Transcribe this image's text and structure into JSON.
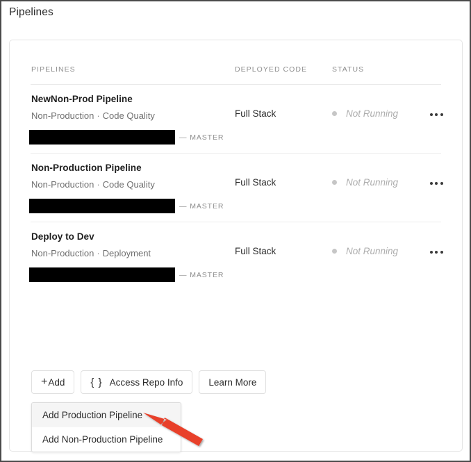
{
  "page": {
    "title": "Pipelines"
  },
  "table": {
    "headers": {
      "pipelines": "PIPELINES",
      "deployed_code": "DEPLOYED CODE",
      "status": "STATUS"
    },
    "rows": [
      {
        "name": "NewNon-Prod Pipeline",
        "environment": "Non-Production",
        "separator": "·",
        "type": "Code Quality",
        "repo_redacted": true,
        "branch": "— MASTER",
        "deployed_code": "Full Stack",
        "status": "Not Running",
        "status_color": "#c6c6c6",
        "menu_icon": "ellipsis-icon"
      },
      {
        "name": "Non-Production Pipeline",
        "environment": "Non-Production",
        "separator": "·",
        "type": "Code Quality",
        "repo_redacted": true,
        "branch": "— MASTER",
        "deployed_code": "Full Stack",
        "status": "Not Running",
        "status_color": "#c6c6c6",
        "menu_icon": "ellipsis-icon"
      },
      {
        "name": "Deploy to Dev",
        "environment": "Non-Production",
        "separator": "·",
        "type": "Deployment",
        "repo_redacted": true,
        "branch": "— MASTER",
        "deployed_code": "Full Stack",
        "status": "Not Running",
        "status_color": "#c6c6c6",
        "menu_icon": "ellipsis-icon"
      }
    ]
  },
  "actions": {
    "add": {
      "label": "Add",
      "icon": "plus-icon"
    },
    "access_repo_info": {
      "label": "Access Repo Info",
      "icon": "braces-icon",
      "icon_glyph": "{ }"
    },
    "learn_more": {
      "label": "Learn More"
    }
  },
  "dropdown": {
    "open": true,
    "items": [
      {
        "label": "Add Production Pipeline",
        "highlighted": true
      },
      {
        "label": "Add Non-Production Pipeline",
        "highlighted": false
      }
    ]
  },
  "annotation": {
    "arrow_color": "#e8402a",
    "points_to": "Add Production Pipeline"
  }
}
